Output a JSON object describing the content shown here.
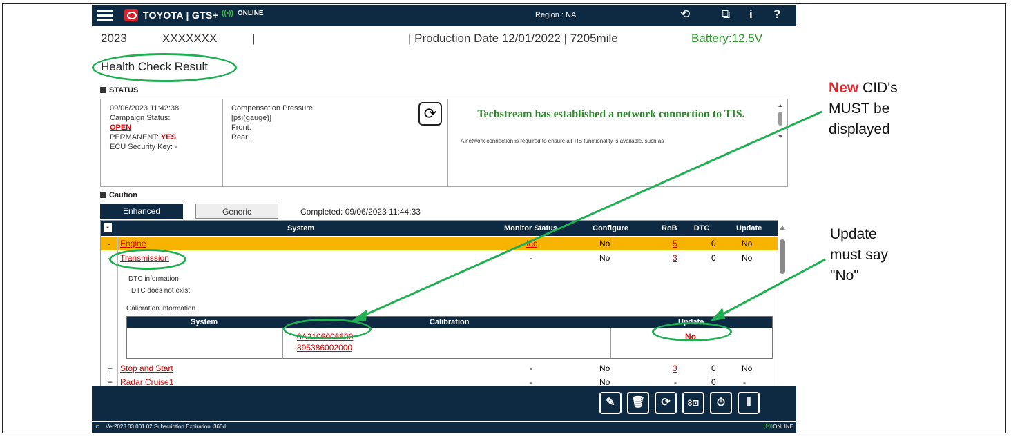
{
  "topbar": {
    "brand": "TOYOTA | GTS+",
    "online_label": "ONLINE",
    "region": "Region : NA",
    "icons": [
      "menu-icon",
      "toyota-logo",
      "wifi-icon",
      "history-icon",
      "external-link-icon",
      "info-icon",
      "help-icon"
    ]
  },
  "vehicle": {
    "year": "2023",
    "vin": "XXXXXXX",
    "separator": "|",
    "production": "| Production Date 12/01/2022  |  7205mile",
    "battery": "Battery:12.5V"
  },
  "page_title": "Health Check Result",
  "status": {
    "heading": "STATUS",
    "datetime": "09/06/2023 11:42:38",
    "campaign_label": "Campaign Status:",
    "campaign_value": "OPEN",
    "permanent_label": "PERMANENT: ",
    "permanent_value": "YES",
    "ecu_key": "ECU Security Key: -",
    "compensation_title": "Compensation Pressure",
    "compensation_unit": "[psi(gauge)]",
    "front": "Front:",
    "rear": "Rear:",
    "tis_message": "Techstream has established a network connection to TIS.",
    "tis_sub": "A network connection is required to ensure all TIS functionality is available, such as"
  },
  "caution": {
    "heading": "Caution",
    "tab_enhanced": "Enhanced",
    "tab_generic": "Generic",
    "completed": "Completed: 09/06/2023 11:44:33",
    "columns": [
      "System",
      "Monitor Status",
      "Configure",
      "RoB",
      "DTC",
      "Update"
    ],
    "rows": [
      {
        "system": "Engine",
        "monitor": "Inc",
        "configure": "No",
        "rob": "5",
        "dtc": "0",
        "update": "No",
        "highlight": true
      },
      {
        "system": "Transmission",
        "monitor": "-",
        "configure": "No",
        "rob": "3",
        "dtc": "0",
        "update": "No",
        "highlight": false
      }
    ],
    "dtc_info_label": "DTC information",
    "dtc_info_value": "DTC does not exist.",
    "cal_info_label": "Calibration information",
    "cal_columns": [
      "System",
      "Calibration",
      "Update"
    ],
    "cal_ids": [
      "8A2106006600",
      "895386002000"
    ],
    "cal_update": "No",
    "rows_after": [
      {
        "system": "Stop and Start",
        "monitor": "-",
        "configure": "No",
        "rob": "3",
        "dtc": "0",
        "update": "No"
      },
      {
        "system": "Radar Cruise1",
        "monitor": "-",
        "configure": "No",
        "rob": "-",
        "dtc": "0",
        "update": "-"
      }
    ]
  },
  "footer": {
    "version": "Ver2023.03.001.02  Subscription Expiration: 360d",
    "online": "ONLINE",
    "buttons": [
      "edit-icon",
      "trash-icon",
      "refresh-icon",
      "compare-icon",
      "timer-icon",
      "tools-icon"
    ]
  },
  "annotations": {
    "cid_new": "New",
    "cid_rest": " CID's",
    "cid_line2": "MUST be",
    "cid_line3": "displayed",
    "update_line1": "Update",
    "update_line2": "must say",
    "update_line3": "\"No\""
  },
  "colors": {
    "navy": "#0e2a43",
    "highlight": "#f6b400",
    "annot_green": "#1fae52",
    "red": "#d00000"
  }
}
